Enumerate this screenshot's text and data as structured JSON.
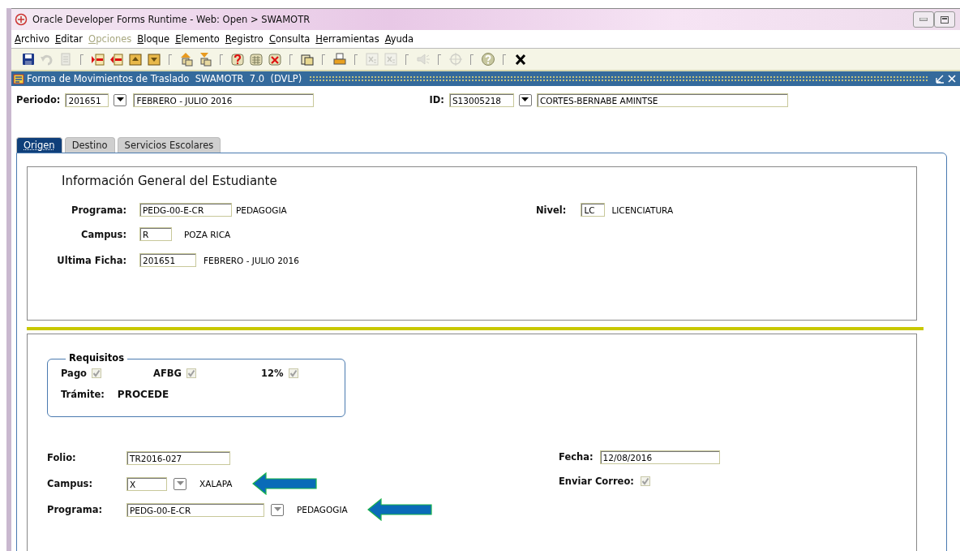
{
  "window": {
    "title": "Oracle Developer Forms Runtime - Web:  Open > SWAMOTR"
  },
  "menu": [
    {
      "label": "Archivo",
      "disabled": false
    },
    {
      "label": "Editar",
      "disabled": false
    },
    {
      "label": "Opciones",
      "disabled": true
    },
    {
      "label": "Bloque",
      "disabled": false
    },
    {
      "label": "Elemento",
      "disabled": false
    },
    {
      "label": "Registro",
      "disabled": false
    },
    {
      "label": "Consulta",
      "disabled": false
    },
    {
      "label": "Herramientas",
      "disabled": false
    },
    {
      "label": "Ayuda",
      "disabled": false
    }
  ],
  "toolbar": [
    {
      "kind": "save",
      "disabled": false
    },
    {
      "kind": "undo",
      "disabled": true
    },
    {
      "kind": "document",
      "disabled": true
    },
    {
      "kind": "separator"
    },
    {
      "kind": "insert",
      "disabled": false
    },
    {
      "kind": "remove",
      "disabled": false
    },
    {
      "kind": "up",
      "disabled": false
    },
    {
      "kind": "down",
      "disabled": false
    },
    {
      "kind": "separator"
    },
    {
      "kind": "stack-up",
      "disabled": false
    },
    {
      "kind": "stack-down",
      "disabled": false
    },
    {
      "kind": "separator"
    },
    {
      "kind": "query",
      "disabled": false
    },
    {
      "kind": "table",
      "disabled": false
    },
    {
      "kind": "delete",
      "disabled": false
    },
    {
      "kind": "separator"
    },
    {
      "kind": "copy",
      "disabled": false
    },
    {
      "kind": "separator"
    },
    {
      "kind": "print",
      "disabled": false
    },
    {
      "kind": "separator"
    },
    {
      "kind": "xs",
      "disabled": true
    },
    {
      "kind": "xs",
      "disabled": true
    },
    {
      "kind": "separator"
    },
    {
      "kind": "speaker",
      "disabled": true
    },
    {
      "kind": "separator"
    },
    {
      "kind": "target",
      "disabled": true
    },
    {
      "kind": "separator"
    },
    {
      "kind": "help",
      "disabled": false
    },
    {
      "kind": "separator"
    },
    {
      "kind": "exit",
      "disabled": false
    }
  ],
  "form": {
    "title": "Forma de Movimientos de Traslado  SWAMOTR  7.0  (DVLP)"
  },
  "header": {
    "periodo": {
      "label": "Periodo:",
      "code": "201651",
      "description": "FEBRERO - JULIO 2016"
    },
    "id": {
      "label": "ID:",
      "code": "S13005218",
      "description": "CORTES-BERNABE AMINTSE"
    }
  },
  "tabs": [
    {
      "label": "Origen",
      "selected": true
    },
    {
      "label": "Destino",
      "selected": false
    },
    {
      "label": "Servicios Escolares",
      "selected": false
    }
  ],
  "general": {
    "title": "Información General del Estudiante",
    "fields": [
      {
        "label": "Programa:",
        "value": "PEDG-00-E-CR",
        "description": "PEDAGOGIA"
      },
      {
        "label": "Campus:",
        "value": "R",
        "description": "POZA RICA"
      },
      {
        "label": "Ultima Ficha:",
        "value": "201651",
        "description": "FEBRERO - JULIO 2016"
      }
    ],
    "nivel": {
      "label": "Nivel:",
      "value": "LC",
      "description": "LICENCIATURA"
    }
  },
  "requisitos": {
    "title": "Requisitos",
    "checks": [
      {
        "label": "Pago",
        "checked": true,
        "disabled": true
      },
      {
        "label": "AFBG",
        "checked": true,
        "disabled": true
      },
      {
        "label": "12%",
        "checked": true,
        "disabled": true
      }
    ],
    "tramite": {
      "label": "Trámite:",
      "value": "PROCEDE"
    }
  },
  "destino": {
    "folio": {
      "label": "Folio:",
      "value": "TR2016-027"
    },
    "campus": {
      "label": "Campus:",
      "value": "X",
      "description": "XALAPA"
    },
    "programa": {
      "label": "Programa:",
      "value": "PEDG-00-E-CR",
      "description": "PEDAGOGIA"
    },
    "fecha": {
      "label": "Fecha:",
      "value": "12/08/2016"
    },
    "enviar_correo": {
      "label": "Enviar Correo:",
      "checked": true,
      "disabled": true
    }
  }
}
